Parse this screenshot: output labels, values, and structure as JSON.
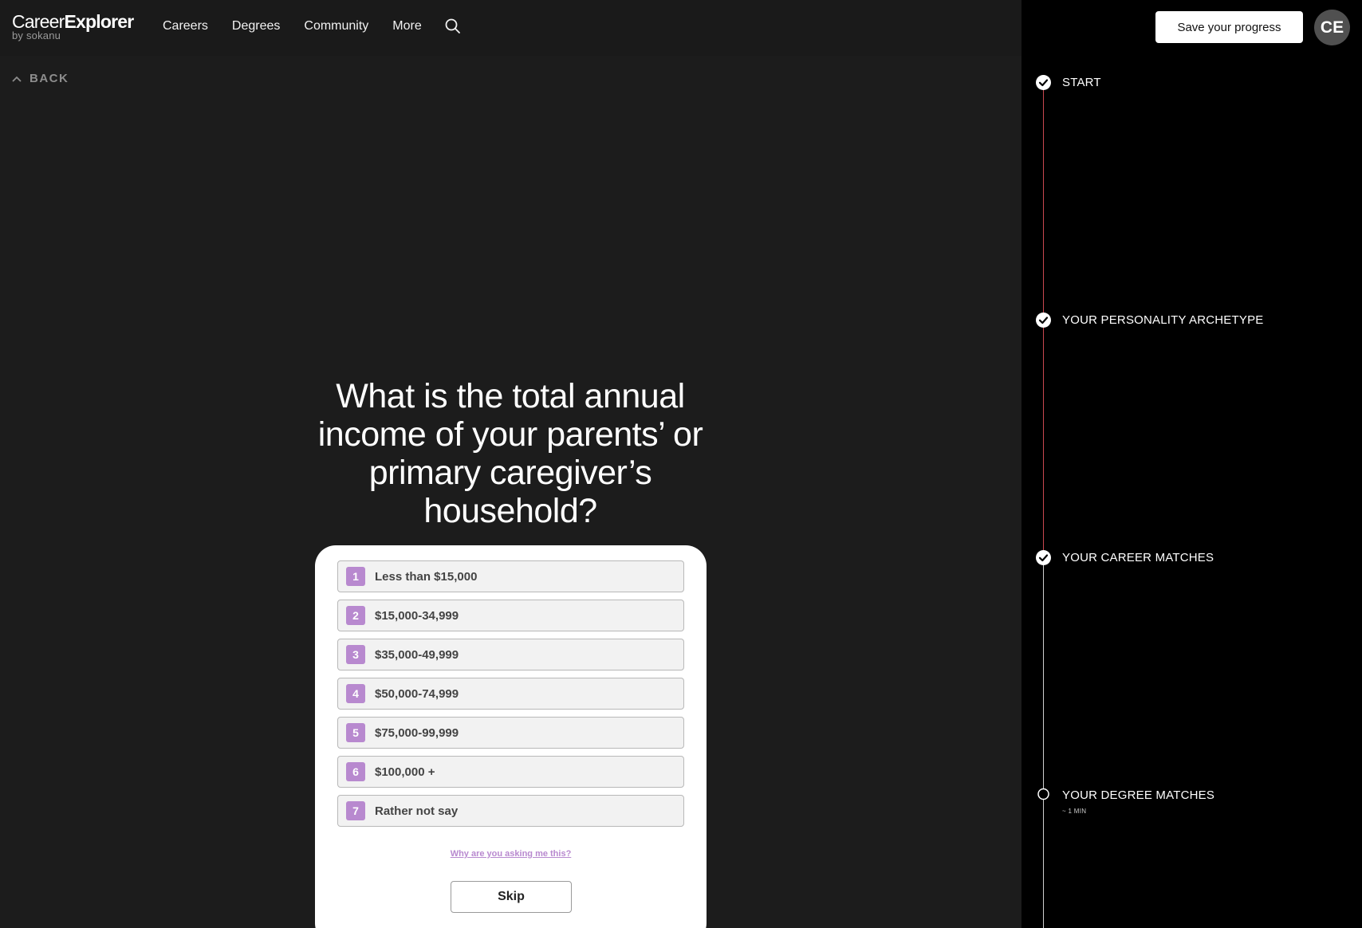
{
  "header": {
    "logo_main_a": "Career",
    "logo_main_b": "Explorer",
    "logo_sub": "by sokanu",
    "nav": [
      "Careers",
      "Degrees",
      "Community",
      "More"
    ],
    "search_icon": "search-icon"
  },
  "back_label": "BACK",
  "question": {
    "line1": "What is the total annual",
    "line2": "income of your parents’ or",
    "line3": "primary caregiver’s",
    "line4": "household?"
  },
  "options": [
    {
      "num": "1",
      "label": "Less than $15,000"
    },
    {
      "num": "2",
      "label": "$15,000-34,999"
    },
    {
      "num": "3",
      "label": "$35,000-49,999"
    },
    {
      "num": "4",
      "label": "$50,000-74,999"
    },
    {
      "num": "5",
      "label": "$75,000-99,999"
    },
    {
      "num": "6",
      "label": "$100,000 +"
    },
    {
      "num": "7",
      "label": "Rather not say"
    }
  ],
  "why_link": "Why are you asking me this?",
  "skip_label": "Skip",
  "panel": {
    "save_label": "Save your progress",
    "avatar_initials": "CE",
    "steps": [
      {
        "label": "START",
        "status": "complete",
        "icon": "check-circle-icon"
      },
      {
        "label": "YOUR PERSONALITY ARCHETYPE",
        "status": "complete",
        "icon": "check-circle-icon"
      },
      {
        "label": "YOUR CAREER MATCHES",
        "status": "complete",
        "icon": "check-circle-icon"
      },
      {
        "label": "YOUR DEGREE MATCHES",
        "status": "current",
        "icon": "empty-circle-icon",
        "sub": "~ 1 MIN"
      }
    ]
  },
  "colors": {
    "background": "#1c1c1c",
    "panel": "#000000",
    "accent_purple": "#b889cf",
    "progress_line_red": "#c8484f"
  }
}
